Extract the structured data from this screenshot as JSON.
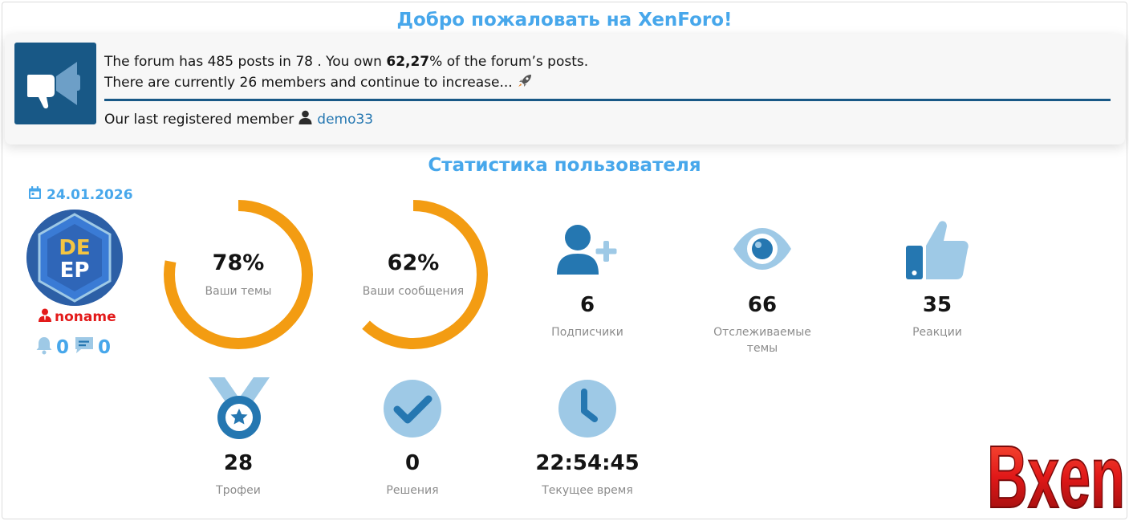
{
  "welcome": {
    "title": "Добро пожаловать на XenForo!",
    "line1_prefix": "The forum has 485 posts in 78 . You own ",
    "line1_percent": "62,27",
    "line1_suffix": "% of the forum’s posts.",
    "line2": "There are currently 26 members and continue to increase...",
    "last_member_label": "Our last registered member",
    "last_member_name": "demo33"
  },
  "stats": {
    "title": "Статистика пользователя",
    "date": "24.01.2026",
    "avatar_text_top": "DE",
    "avatar_text_bottom": "EP",
    "username": "noname",
    "alerts_count": "0",
    "conversations_count": "0",
    "ring_threads": {
      "value": "78%",
      "label": "Ваши темы",
      "fraction": 0.78
    },
    "ring_posts": {
      "value": "62%",
      "label": "Ваши сообщения",
      "fraction": 0.62
    },
    "followers": {
      "value": "6",
      "label": "Подписчики"
    },
    "watched": {
      "value": "66",
      "label_line1": "Отслеживаемые",
      "label_line2": "темы"
    },
    "reactions": {
      "value": "35",
      "label": "Реакции"
    },
    "trophies": {
      "value": "28",
      "label": "Трофеи"
    },
    "solutions": {
      "value": "0",
      "label": "Решения"
    },
    "time": {
      "value": "22:54:45",
      "label": "Текущее время"
    }
  },
  "logo_text": "Bxen",
  "colors": {
    "accent": "#47a7eb",
    "dark_blue": "#185886",
    "ring": "#f39c12",
    "icon_blue": "#2577b1",
    "icon_light": "#9ec9e6"
  }
}
